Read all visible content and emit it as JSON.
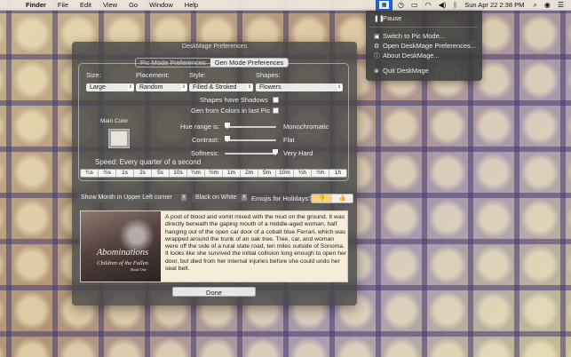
{
  "menubar": {
    "apple_glyph": "",
    "app_name": "Finder",
    "items": [
      "File",
      "Edit",
      "View",
      "Go",
      "Window",
      "Help"
    ],
    "clock": "Sun Apr 22  2:38 PM",
    "status_icons": [
      "deskmage-icon",
      "clock-icon",
      "battery-icon",
      "wifi-icon",
      "volume-icon",
      "bluetooth-icon",
      "search-icon",
      "siri-icon",
      "notification-icon"
    ]
  },
  "dropdown": {
    "pause": "Pause",
    "switch_mode": "Switch to Pic Mode...",
    "open_prefs": "Open DeskMage Preferences...",
    "about": "About DeskMage...",
    "quit": "Quit DeskMage"
  },
  "window": {
    "title": "DeskMage Preferences",
    "tabs": [
      "Pic Mode Preferences",
      "Gen Mode Preferences"
    ],
    "active_tab": "Gen Mode Preferences",
    "size": {
      "label": "Size:",
      "value": "Large"
    },
    "placement": {
      "label": "Placement:",
      "value": "Random"
    },
    "style": {
      "label": "Style:",
      "value": "Filled & Stroked"
    },
    "shapes": {
      "label": "Shapes:",
      "value": "Flowers"
    },
    "shadows_label": "Shapes have Shadows",
    "gen_colors_label": "Gen from Colors in last Pic",
    "main_color_label": "Main Color",
    "main_color": "#e8e2da",
    "hue_range": {
      "label": "Hue range is:",
      "value_label": "Monochromatic",
      "level": 0.0
    },
    "contrast": {
      "label": "Contrast:",
      "value_label": "Flat",
      "level": 0.0
    },
    "softness": {
      "label": "Softness:",
      "value_label": "Very Hard",
      "level": 1.0
    },
    "speed_text": "Speed: Every quarter of a second",
    "speed_options": [
      "¼s",
      "½s",
      "1s",
      "2s",
      "5s",
      "10s",
      "¼m",
      "½m",
      "1m",
      "2m",
      "5m",
      "10m",
      "¼h",
      "½h",
      "1h"
    ],
    "month_option": "Show Month in Upper Left corner",
    "color_option": "Black on White",
    "emoji_label": "Emojis for Holidays?",
    "emoji_options": [
      "👎",
      "👍"
    ],
    "book": {
      "title": "Abominations",
      "subtitle": "Children of the Fallen",
      "book_no": "Book One"
    },
    "story": "A pool of blood and vomit mixed with the mud on the ground. It was directly beneath the gaping mouth of a middle-aged woman, half hanging out of the open car door of a cobalt blue Ferrari, which was wrapped around the trunk of an oak tree. Tree, car, and woman were off the side of a rural state road, ten miles outside of Sonoma. It looks like she survived the initial collision long enough to open her door, but died from her internal injuries before she could undo her seat belt.",
    "done_label": "Done"
  }
}
